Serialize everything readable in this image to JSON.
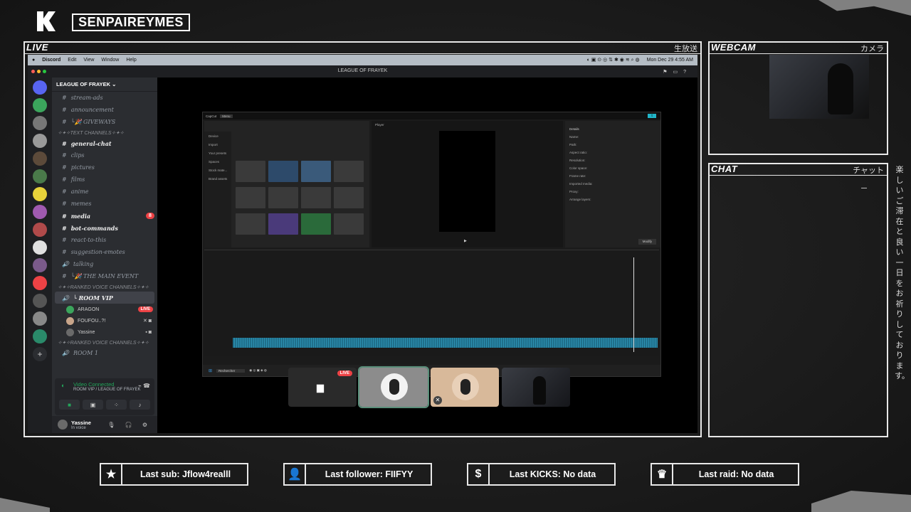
{
  "branding": {
    "channel_name": "SENPAIREYMES",
    "logo_icon": "k-logo-icon"
  },
  "panels": {
    "live": {
      "title": "LIVE",
      "jp": "生放送"
    },
    "webcam": {
      "title": "WEBCAM",
      "jp": "カメラ"
    },
    "chat": {
      "title": "CHAT",
      "jp": "チャット"
    },
    "side_jp": "楽しいご滞在と良い一日をお祈りしております。"
  },
  "macbar": {
    "app": "Discord",
    "menus": [
      "Edit",
      "View",
      "Window",
      "Help"
    ],
    "clock": "Mon Dec 29  4:55 AM"
  },
  "discord": {
    "window_title": "LEAGUE OF FRAYEK",
    "guild_name": "LEAGUE OF FRAYEK",
    "channels": [
      {
        "prefix": "#",
        "name": "stream-ads",
        "style": "dim"
      },
      {
        "prefix": "#",
        "name": "announcement",
        "style": "dim"
      },
      {
        "prefix": "#",
        "name": "└🎉 GIVEWAYS",
        "style": "dim"
      }
    ],
    "category_text": "✧✦✧TEXT CHANNELS✧✦✧",
    "text_channels": [
      {
        "prefix": "#",
        "name": "general-chat",
        "style": "white"
      },
      {
        "prefix": "#",
        "name": "clips",
        "style": "dim"
      },
      {
        "prefix": "#",
        "name": "pictures",
        "style": "dim"
      },
      {
        "prefix": "#",
        "name": "films",
        "style": "dim"
      },
      {
        "prefix": "#",
        "name": "anime",
        "style": "dim"
      },
      {
        "prefix": "#",
        "name": "memes",
        "style": "dim"
      },
      {
        "prefix": "#",
        "name": "media",
        "style": "white"
      },
      {
        "prefix": "#",
        "name": "bot-commands",
        "style": "white"
      },
      {
        "prefix": "#",
        "name": "react-to-this",
        "style": "dim"
      },
      {
        "prefix": "#",
        "name": "suggestion-emotes",
        "style": "dim"
      },
      {
        "prefix": "🔊",
        "name": "talking",
        "style": "dim"
      },
      {
        "prefix": "#",
        "name": "└🎉 THE MAIN EVENT",
        "style": "dim"
      }
    ],
    "category_voice": "✧✦✧RANKED VOICE CHANNELS✧✦✧",
    "room_vip": "└ ROOM VIP",
    "voice_users": [
      {
        "name": "ARAGON",
        "live": "LIVE"
      },
      {
        "name": "FOUFOU..?!",
        "live": ""
      },
      {
        "name": "Yassine",
        "live": ""
      }
    ],
    "category_voice2": "✧✦✧RANKED VOICE CHANNELS✧✦✧",
    "room_1": "ROOM 1",
    "media_badge": "8",
    "voice_status": {
      "title": "Video Connected",
      "subtitle": "ROOM VIP / LEAGUE OF FRAYEK"
    },
    "user": {
      "name": "Yassine",
      "status": "In voice"
    }
  },
  "capcut": {
    "menu": [
      "CapCut",
      "Menu"
    ],
    "sidebar": [
      "Device",
      "Import",
      "Your presets",
      "Spaces",
      "Stock mate...",
      "Brand assets"
    ],
    "player_label": "Player",
    "details_label": "Details",
    "details_rows": [
      "Name:",
      "Path:",
      "Aspect ratio:",
      "Resolution:",
      "Color space:",
      "Frame rate:",
      "Imported media:",
      "Proxy:",
      "Arrange layers:"
    ],
    "modify_label": "Modify",
    "taskbar_search": "Rechercher"
  },
  "alerts": [
    {
      "icon": "star-icon",
      "glyph": "★",
      "text": "Last sub: Jflow4realll"
    },
    {
      "icon": "user-plus-icon",
      "glyph": "👤",
      "text": "Last follower: FIIFYY"
    },
    {
      "icon": "dollar-icon",
      "glyph": "$",
      "text": "Last KICKS: No data"
    },
    {
      "icon": "crown-icon",
      "glyph": "♛",
      "text": "Last raid: No data"
    }
  ],
  "colors": {
    "accent_live": "#ed4245",
    "voice_green": "#23a55a",
    "frame": "#e8e8e8"
  }
}
